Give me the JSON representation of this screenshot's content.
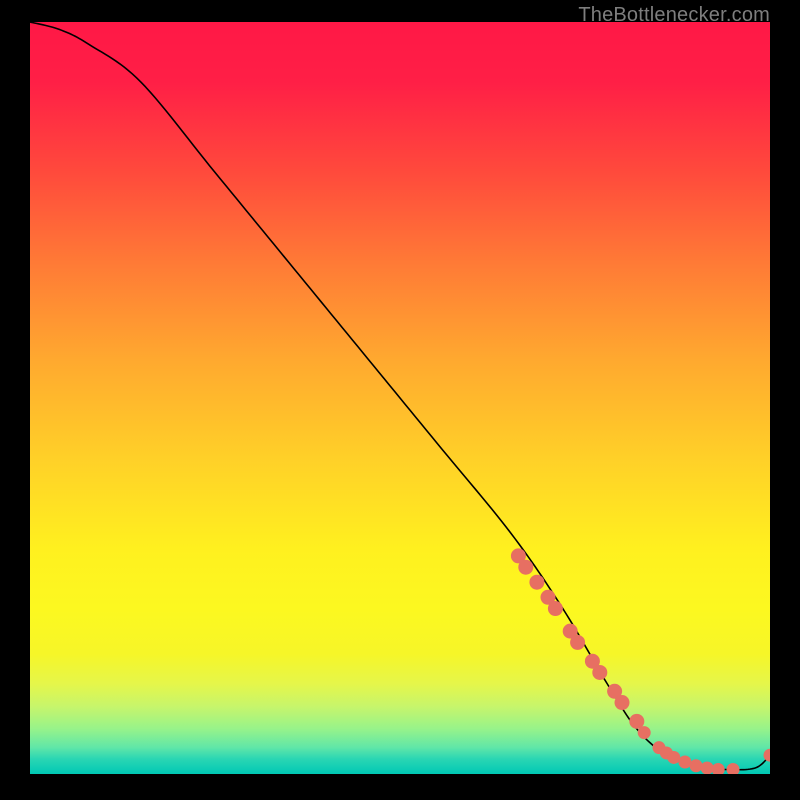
{
  "source_label": "TheBottlenecker.com",
  "chart_data": {
    "type": "line",
    "title": "",
    "xlabel": "",
    "ylabel": "",
    "xlim": [
      0,
      100
    ],
    "ylim": [
      0,
      100
    ],
    "curve": {
      "name": "bottleneck-curve",
      "x": [
        0,
        4,
        8,
        15,
        25,
        35,
        45,
        55,
        65,
        72,
        78,
        82,
        86,
        90,
        94,
        98,
        100
      ],
      "y": [
        100,
        99,
        97,
        92,
        80,
        68,
        56,
        44,
        32,
        22,
        12,
        6,
        2.5,
        1,
        0.6,
        0.8,
        2.5
      ]
    },
    "markers": {
      "name": "highlighted-points",
      "color": "#e76f62",
      "x": [
        66,
        67,
        68.5,
        70,
        71,
        73,
        74,
        76,
        77,
        79,
        80,
        82,
        83,
        85,
        86,
        87,
        88.5,
        90,
        91.5,
        93,
        95,
        100
      ],
      "y": [
        29,
        27.5,
        25.5,
        23.5,
        22,
        19,
        17.5,
        15,
        13.5,
        11,
        9.5,
        7,
        5.5,
        3.5,
        2.8,
        2.2,
        1.6,
        1.1,
        0.8,
        0.6,
        0.6,
        2.5
      ]
    },
    "gradient_stops": [
      {
        "pos": 0,
        "color": "#ff1846"
      },
      {
        "pos": 70,
        "color": "#fff01f"
      },
      {
        "pos": 100,
        "color": "#00c8b4"
      }
    ]
  }
}
